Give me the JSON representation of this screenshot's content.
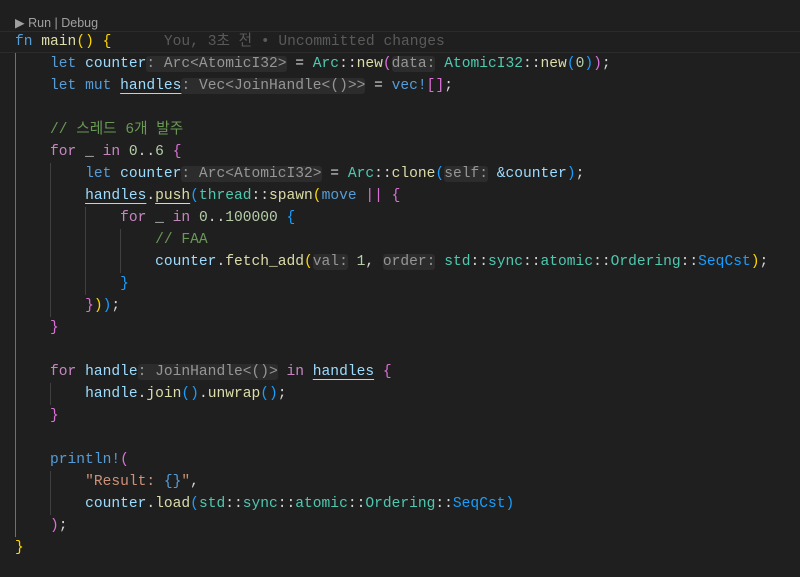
{
  "codelens": {
    "run": "Run",
    "sep": " | ",
    "debug": "Debug"
  },
  "blame": "You, 3초 전 • Uncommitted changes",
  "lines": [
    {
      "indent": 0,
      "current": true,
      "t": [
        [
          "fn",
          "kw"
        ],
        [
          " ",
          "p"
        ],
        [
          "main",
          "fn"
        ],
        [
          "(",
          "b1"
        ],
        [
          ")",
          "b1"
        ],
        [
          " ",
          "p"
        ],
        [
          "{",
          "b1"
        ]
      ]
    },
    {
      "indent": 1,
      "t": [
        [
          "let",
          "kw"
        ],
        [
          " ",
          "p"
        ],
        [
          "counter",
          "var"
        ],
        [
          ": Arc<AtomicI32>",
          "hint"
        ],
        [
          " = ",
          "p"
        ],
        [
          "Arc",
          "ty"
        ],
        [
          "::",
          "p"
        ],
        [
          "new",
          "fn"
        ],
        [
          "(",
          "b2"
        ],
        [
          "data:",
          "hint"
        ],
        [
          " ",
          "p"
        ],
        [
          "AtomicI32",
          "ty"
        ],
        [
          "::",
          "p"
        ],
        [
          "new",
          "fn"
        ],
        [
          "(",
          "b3"
        ],
        [
          "0",
          "num"
        ],
        [
          ")",
          "b3"
        ],
        [
          ")",
          "b2"
        ],
        [
          ";",
          "p"
        ]
      ]
    },
    {
      "indent": 1,
      "t": [
        [
          "let",
          "kw"
        ],
        [
          " ",
          "p"
        ],
        [
          "mut",
          "kw"
        ],
        [
          " ",
          "p"
        ],
        [
          "handles",
          "mut"
        ],
        [
          ": Vec<JoinHandle<()>>",
          "hint"
        ],
        [
          " = ",
          "p"
        ],
        [
          "vec!",
          "kw"
        ],
        [
          "[",
          "b2"
        ],
        [
          "]",
          "b2"
        ],
        [
          ";",
          "p"
        ]
      ]
    },
    {
      "indent": 1,
      "t": []
    },
    {
      "indent": 1,
      "t": [
        [
          "// 스레드 6개 발주",
          "cm"
        ]
      ]
    },
    {
      "indent": 1,
      "t": [
        [
          "for",
          "ctl"
        ],
        [
          " _ ",
          "p"
        ],
        [
          "in",
          "ctl"
        ],
        [
          " ",
          "p"
        ],
        [
          "0",
          "num"
        ],
        [
          "..",
          "p"
        ],
        [
          "6",
          "num"
        ],
        [
          " ",
          "p"
        ],
        [
          "{",
          "b2"
        ]
      ]
    },
    {
      "indent": 2,
      "t": [
        [
          "let",
          "kw"
        ],
        [
          " ",
          "p"
        ],
        [
          "counter",
          "var"
        ],
        [
          ": Arc<AtomicI32>",
          "hint"
        ],
        [
          " = ",
          "p"
        ],
        [
          "Arc",
          "ty"
        ],
        [
          "::",
          "p"
        ],
        [
          "clone",
          "fn"
        ],
        [
          "(",
          "b3"
        ],
        [
          "self:",
          "hint"
        ],
        [
          " ",
          "p"
        ],
        [
          "&counter",
          "var"
        ],
        [
          ")",
          "b3"
        ],
        [
          ";",
          "p"
        ]
      ]
    },
    {
      "indent": 2,
      "t": [
        [
          "handles",
          "mut"
        ],
        [
          ".",
          "p"
        ],
        [
          "push",
          "fnu"
        ],
        [
          "(",
          "b3"
        ],
        [
          "thread",
          "ty"
        ],
        [
          "::",
          "p"
        ],
        [
          "spawn",
          "fn"
        ],
        [
          "(",
          "b1"
        ],
        [
          "move",
          "kw"
        ],
        [
          " ",
          "p"
        ],
        [
          "||",
          "b2"
        ],
        [
          " ",
          "p"
        ],
        [
          "{",
          "b2"
        ]
      ]
    },
    {
      "indent": 3,
      "t": [
        [
          "for",
          "ctl"
        ],
        [
          " _ ",
          "p"
        ],
        [
          "in",
          "ctl"
        ],
        [
          " ",
          "p"
        ],
        [
          "0",
          "num"
        ],
        [
          "..",
          "p"
        ],
        [
          "100000",
          "num"
        ],
        [
          " ",
          "p"
        ],
        [
          "{",
          "b3"
        ]
      ]
    },
    {
      "indent": 4,
      "t": [
        [
          "// FAA",
          "cm"
        ]
      ]
    },
    {
      "indent": 4,
      "t": [
        [
          "counter",
          "var"
        ],
        [
          ".",
          "p"
        ],
        [
          "fetch_add",
          "fn"
        ],
        [
          "(",
          "b1"
        ],
        [
          "val:",
          "hint"
        ],
        [
          " ",
          "p"
        ],
        [
          "1",
          "num"
        ],
        [
          ", ",
          "p"
        ],
        [
          "order:",
          "hint"
        ],
        [
          " ",
          "p"
        ],
        [
          "std",
          "ty"
        ],
        [
          "::",
          "p"
        ],
        [
          "sync",
          "ty"
        ],
        [
          "::",
          "p"
        ],
        [
          "atomic",
          "ty"
        ],
        [
          "::",
          "p"
        ],
        [
          "Ordering",
          "ty"
        ],
        [
          "::",
          "p"
        ],
        [
          "SeqCst",
          "b3"
        ],
        [
          ")",
          "b1"
        ],
        [
          ";",
          "p"
        ]
      ]
    },
    {
      "indent": 3,
      "t": [
        [
          "}",
          "b3"
        ]
      ]
    },
    {
      "indent": 2,
      "t": [
        [
          "}",
          "b2"
        ],
        [
          ")",
          "b1"
        ],
        [
          ")",
          "b3"
        ],
        [
          ";",
          "p"
        ]
      ]
    },
    {
      "indent": 1,
      "t": [
        [
          "}",
          "b2"
        ]
      ]
    },
    {
      "indent": 1,
      "t": []
    },
    {
      "indent": 1,
      "t": [
        [
          "for",
          "ctl"
        ],
        [
          " ",
          "p"
        ],
        [
          "handle",
          "var"
        ],
        [
          ": JoinHandle<()>",
          "hint"
        ],
        [
          " ",
          "p"
        ],
        [
          "in",
          "ctl"
        ],
        [
          " ",
          "p"
        ],
        [
          "handles",
          "mut"
        ],
        [
          " ",
          "p"
        ],
        [
          "{",
          "b2"
        ]
      ]
    },
    {
      "indent": 2,
      "t": [
        [
          "handle",
          "var"
        ],
        [
          ".",
          "p"
        ],
        [
          "join",
          "fn"
        ],
        [
          "(",
          "b3"
        ],
        [
          ")",
          "b3"
        ],
        [
          ".",
          "p"
        ],
        [
          "unwrap",
          "fn"
        ],
        [
          "(",
          "b3"
        ],
        [
          ")",
          "b3"
        ],
        [
          ";",
          "p"
        ]
      ]
    },
    {
      "indent": 1,
      "t": [
        [
          "}",
          "b2"
        ]
      ]
    },
    {
      "indent": 1,
      "t": []
    },
    {
      "indent": 1,
      "t": [
        [
          "println!",
          "kw"
        ],
        [
          "(",
          "b2"
        ]
      ]
    },
    {
      "indent": 2,
      "t": [
        [
          "\"Result: ",
          "str"
        ],
        [
          "{}",
          "esc"
        ],
        [
          "\"",
          "str"
        ],
        [
          ",",
          "p"
        ]
      ]
    },
    {
      "indent": 2,
      "t": [
        [
          "counter",
          "var"
        ],
        [
          ".",
          "p"
        ],
        [
          "load",
          "fn"
        ],
        [
          "(",
          "b3"
        ],
        [
          "std",
          "ty"
        ],
        [
          "::",
          "p"
        ],
        [
          "sync",
          "ty"
        ],
        [
          "::",
          "p"
        ],
        [
          "atomic",
          "ty"
        ],
        [
          "::",
          "p"
        ],
        [
          "Ordering",
          "ty"
        ],
        [
          "::",
          "p"
        ],
        [
          "SeqCst",
          "b3"
        ],
        [
          ")",
          "b3"
        ]
      ]
    },
    {
      "indent": 1,
      "t": [
        [
          ")",
          "b2"
        ],
        [
          ";",
          "p"
        ]
      ]
    },
    {
      "indent": 0,
      "t": [
        [
          "}",
          "b1"
        ]
      ]
    }
  ]
}
